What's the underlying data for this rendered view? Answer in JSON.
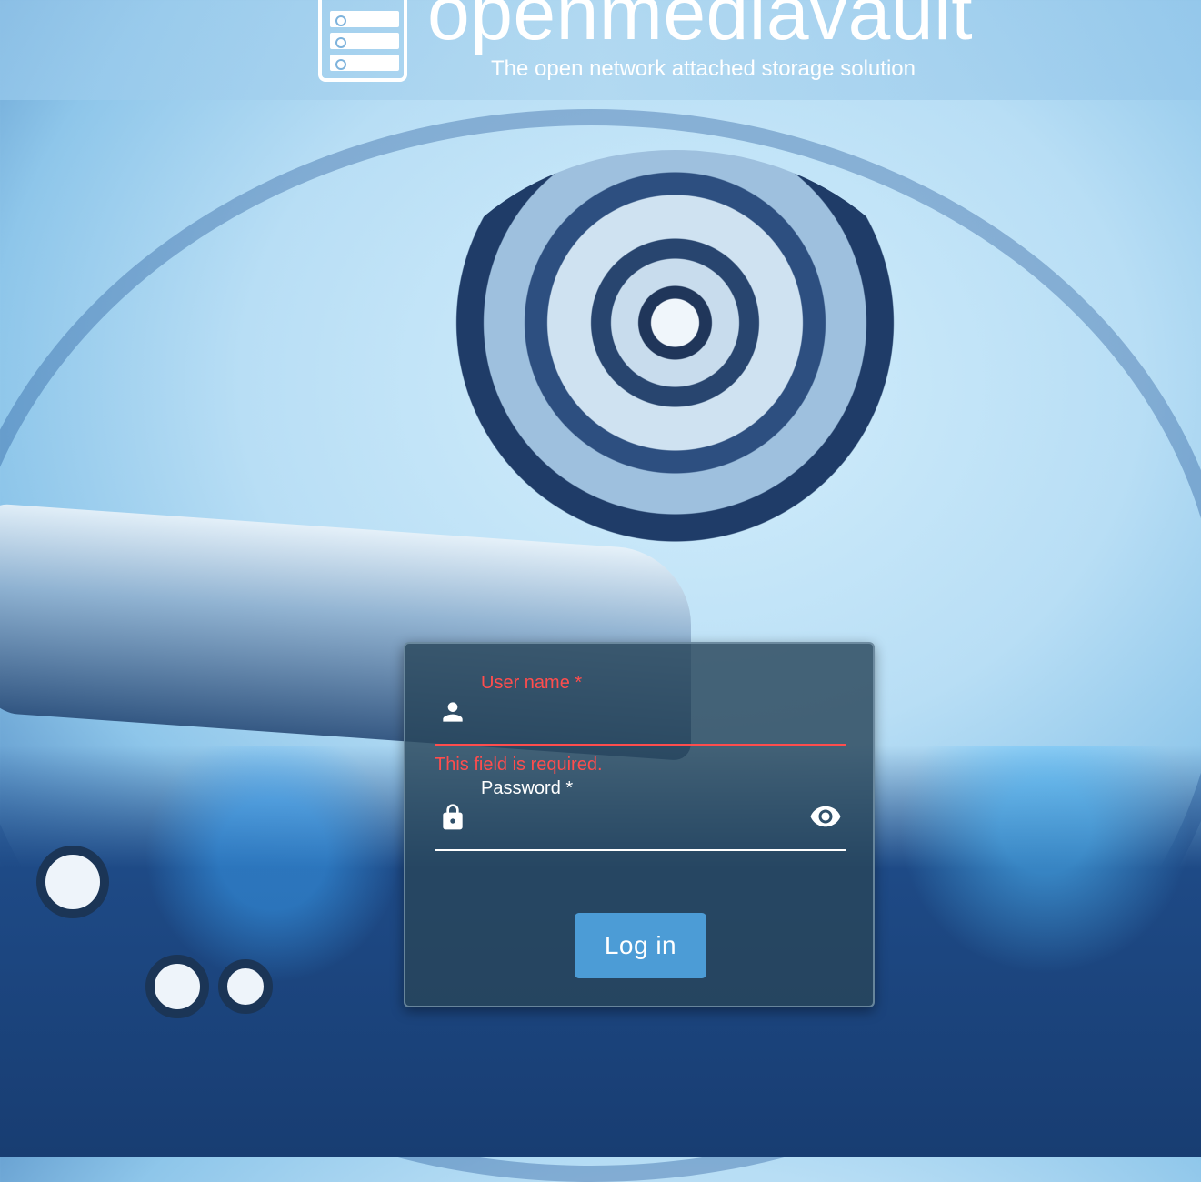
{
  "header": {
    "brand": "openmediavault",
    "tagline": "The open network attached storage solution"
  },
  "login": {
    "username": {
      "label": "User name *",
      "value": "",
      "error": "This field is required.",
      "icon": "person-icon"
    },
    "password": {
      "label": "Password *",
      "value": "",
      "icon": "lock-icon",
      "toggle_icon": "eye-icon"
    },
    "submit_label": "Log in"
  },
  "colors": {
    "error": "#ff4d4d",
    "button": "#4c9cd6",
    "card": "#28465a"
  }
}
